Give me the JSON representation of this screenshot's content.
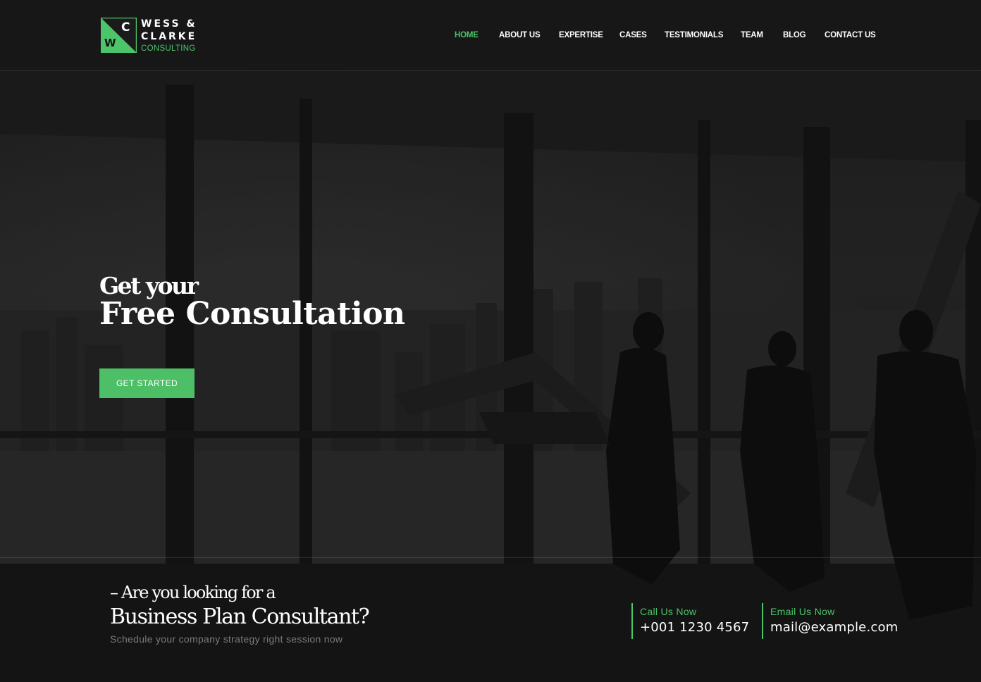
{
  "brand": {
    "mark_top_letter": "C",
    "mark_bottom_letter": "W",
    "line1": "WESS &",
    "line2": "CLARKE",
    "line3": "CONSULTING",
    "accent_color": "#4cc46a"
  },
  "nav": {
    "items": [
      {
        "label": "HOME",
        "active": true
      },
      {
        "label": "ABOUT US",
        "active": false
      },
      {
        "label": "EXPERTISE",
        "active": false
      },
      {
        "label": "CASES",
        "active": false
      },
      {
        "label": "TESTIMONIALS",
        "active": false
      },
      {
        "label": "TEAM",
        "active": false
      },
      {
        "label": "BLOG",
        "active": false
      },
      {
        "label": "CONTACT US",
        "active": false
      }
    ]
  },
  "hero": {
    "pretitle": "Get your",
    "title": "Free Consultation",
    "cta_label": "GET STARTED"
  },
  "bottom": {
    "pretitle": "– Are you looking for a",
    "title": "Business Plan Consultant?",
    "subtitle": "Schedule your company strategy right session now",
    "call": {
      "label": "Call Us Now",
      "value": "+001 1230 4567"
    },
    "email": {
      "label": "Email Us Now",
      "value": "mail@example.com"
    }
  },
  "colors": {
    "accent": "#4cc46a",
    "cta_background": "#4cbf67",
    "background": "#1c1c1c"
  }
}
